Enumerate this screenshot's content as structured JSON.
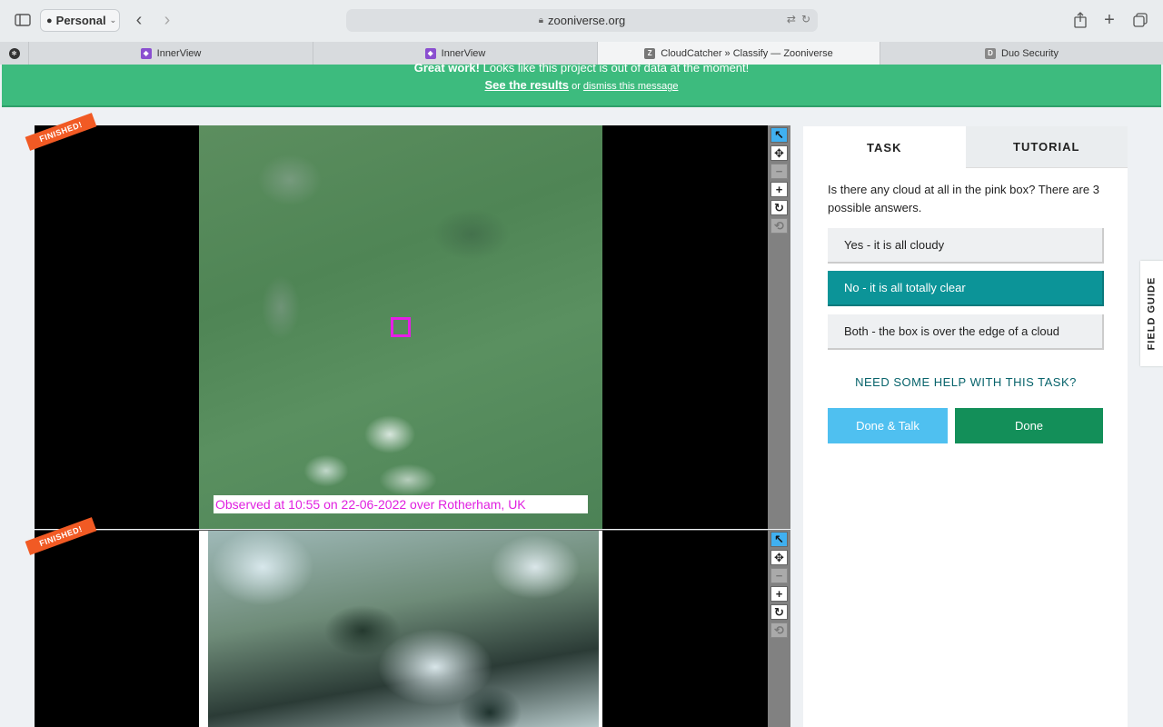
{
  "browser": {
    "profile_label": "Personal",
    "url": "zooniverse.org",
    "tabs": [
      {
        "label": "InnerView",
        "favicon": "innerview-icon"
      },
      {
        "label": "InnerView",
        "favicon": "innerview-icon"
      },
      {
        "label": "CloudCatcher » Classify — Zooniverse",
        "favicon_letter": "Z",
        "active": true
      },
      {
        "label": "Duo Security",
        "favicon_letter": "D"
      }
    ]
  },
  "banner": {
    "bold": "Great work!",
    "text": " Looks like this project is out of data at the moment!",
    "results_link": "See the results",
    "or_text": " or ",
    "dismiss_link": "dismiss this message",
    "color": "#3dbb7e"
  },
  "subjects": [
    {
      "ribbon": "FINISHED!",
      "caption": "Observed at 10:55 on 22-06-2022 over Rotherham, UK"
    },
    {
      "ribbon": "FINISHED!"
    }
  ],
  "tools": {
    "pointer": "↖",
    "move": "✥",
    "zoom_out": "−",
    "zoom_in": "+",
    "rotate": "↻",
    "reset": "⟲"
  },
  "panel": {
    "tab_task": "TASK",
    "tab_tutorial": "TUTORIAL",
    "question": "Is there any cloud at all in the pink box? There are 3 possible answers.",
    "answers": [
      "Yes - it is all cloudy",
      "No - it is all totally clear",
      "Both - the box is over the edge of a cloud"
    ],
    "selected_answer_index": 1,
    "help_link": "NEED SOME HELP WITH THIS TASK?",
    "done_talk": "Done & Talk",
    "done": "Done"
  },
  "field_guide": "FIELD GUIDE",
  "colors": {
    "selected_answer": "#0c9498",
    "done_talk": "#4fc0f0",
    "done": "#138f59",
    "ribbon": "#f15a24",
    "pink_box": "#e61ee6"
  }
}
